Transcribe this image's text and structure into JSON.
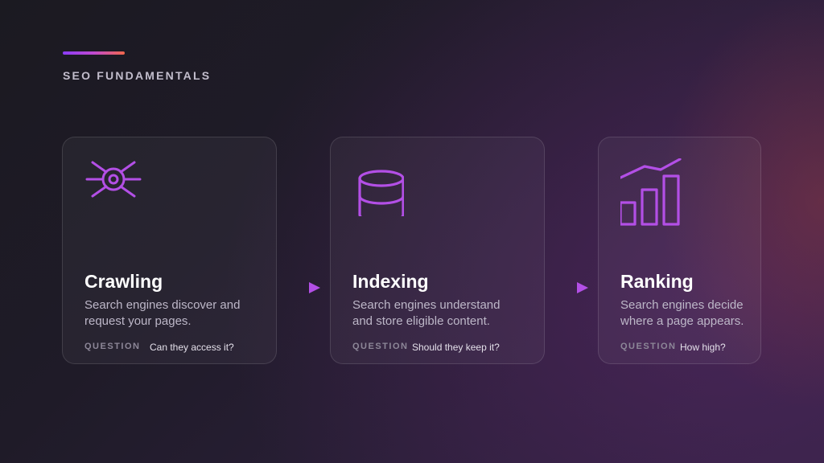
{
  "header": {
    "eyebrow": "SEO FUNDAMENTALS"
  },
  "colors": {
    "accent": "#b34fe6",
    "accent_gradient": [
      "#8b3cf7",
      "#f2674a"
    ]
  },
  "cards": [
    {
      "icon": "crawler-bug-icon",
      "title": "Crawling",
      "description": "Search engines discover and request your pages.",
      "question_label": "QUESTION",
      "question": "Can they access it?"
    },
    {
      "icon": "database-icon",
      "title": "Indexing",
      "description": "Search engines understand and store eligible content.",
      "question_label": "QUESTION",
      "question": "Should they keep it?"
    },
    {
      "icon": "bar-chart-trend-icon",
      "title": "Ranking",
      "description": "Search engines decide where a page appears.",
      "question_label": "QUESTION",
      "question": "How high?"
    }
  ]
}
